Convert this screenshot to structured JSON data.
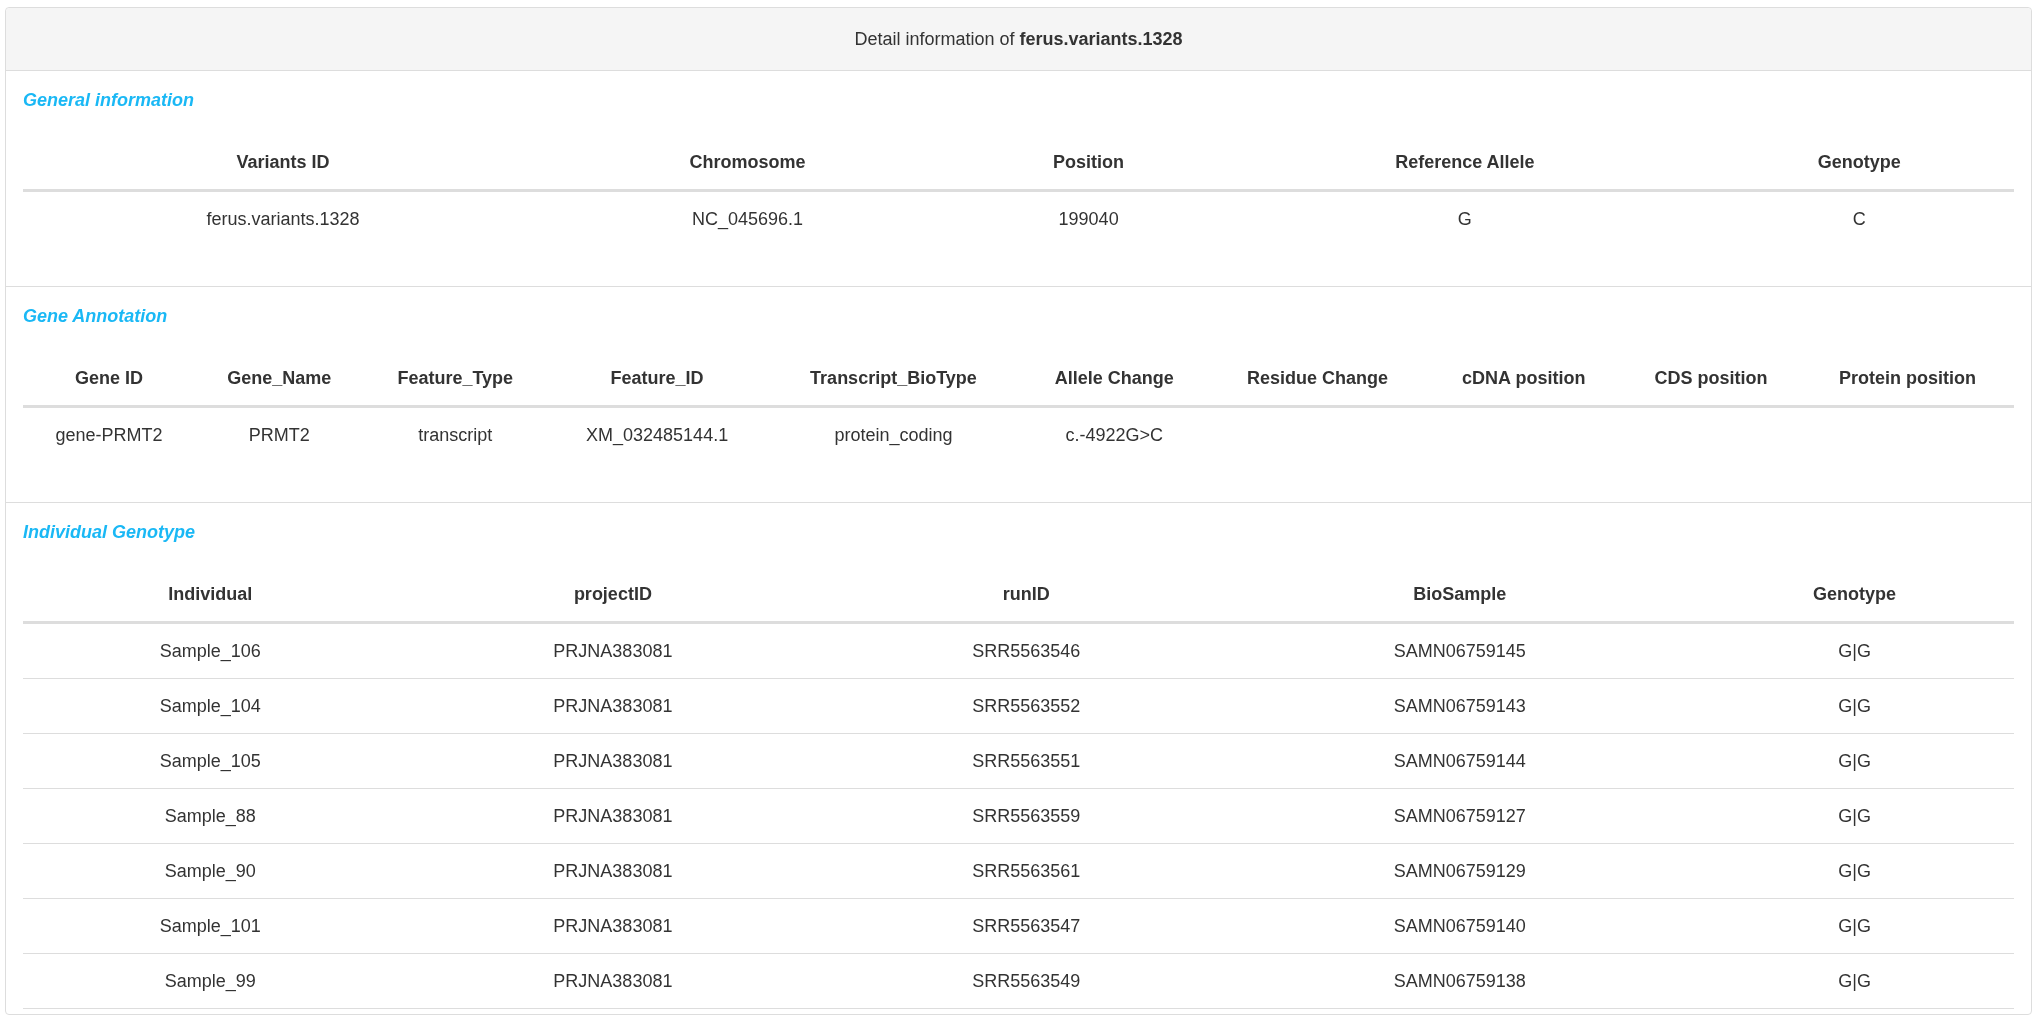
{
  "panel": {
    "title": "Detail information of **ferus.variants.1328**"
  },
  "sections": [
    {
      "title": "General information",
      "columns": [
        "Variants ID",
        "Chromosome",
        "Position",
        "Reference Allele",
        "Genotype"
      ],
      "rows": [
        [
          "ferus.variants.1328",
          "NC_045696.1",
          "199040",
          "G",
          "C"
        ]
      ]
    },
    {
      "title": "Gene Annotation",
      "columns": [
        "Gene ID",
        "Gene_Name",
        "Feature_Type",
        "Feature_ID",
        "Transcript_BioType",
        "Allele Change",
        "Residue Change",
        "cDNA position",
        "CDS position",
        "Protein position"
      ],
      "rows": [
        [
          "gene-PRMT2",
          "PRMT2",
          "transcript",
          "XM_032485144.1",
          "protein_coding",
          "c.-4922G>C",
          "",
          "",
          "",
          ""
        ]
      ]
    },
    {
      "title": "Individual Genotype",
      "columns": [
        "Individual",
        "projectID",
        "runID",
        "BioSample",
        "Genotype"
      ],
      "rows": [
        [
          "Sample_106",
          "PRJNA383081",
          "SRR5563546",
          "SAMN06759145",
          "G|G"
        ],
        [
          "Sample_104",
          "PRJNA383081",
          "SRR5563552",
          "SAMN06759143",
          "G|G"
        ],
        [
          "Sample_105",
          "PRJNA383081",
          "SRR5563551",
          "SAMN06759144",
          "G|G"
        ],
        [
          "Sample_88",
          "PRJNA383081",
          "SRR5563559",
          "SAMN06759127",
          "G|G"
        ],
        [
          "Sample_90",
          "PRJNA383081",
          "SRR5563561",
          "SAMN06759129",
          "G|G"
        ],
        [
          "Sample_101",
          "PRJNA383081",
          "SRR5563547",
          "SAMN06759140",
          "G|G"
        ],
        [
          "Sample_99",
          "PRJNA383081",
          "SRR5563549",
          "SAMN06759138",
          "G|G"
        ]
      ]
    }
  ]
}
